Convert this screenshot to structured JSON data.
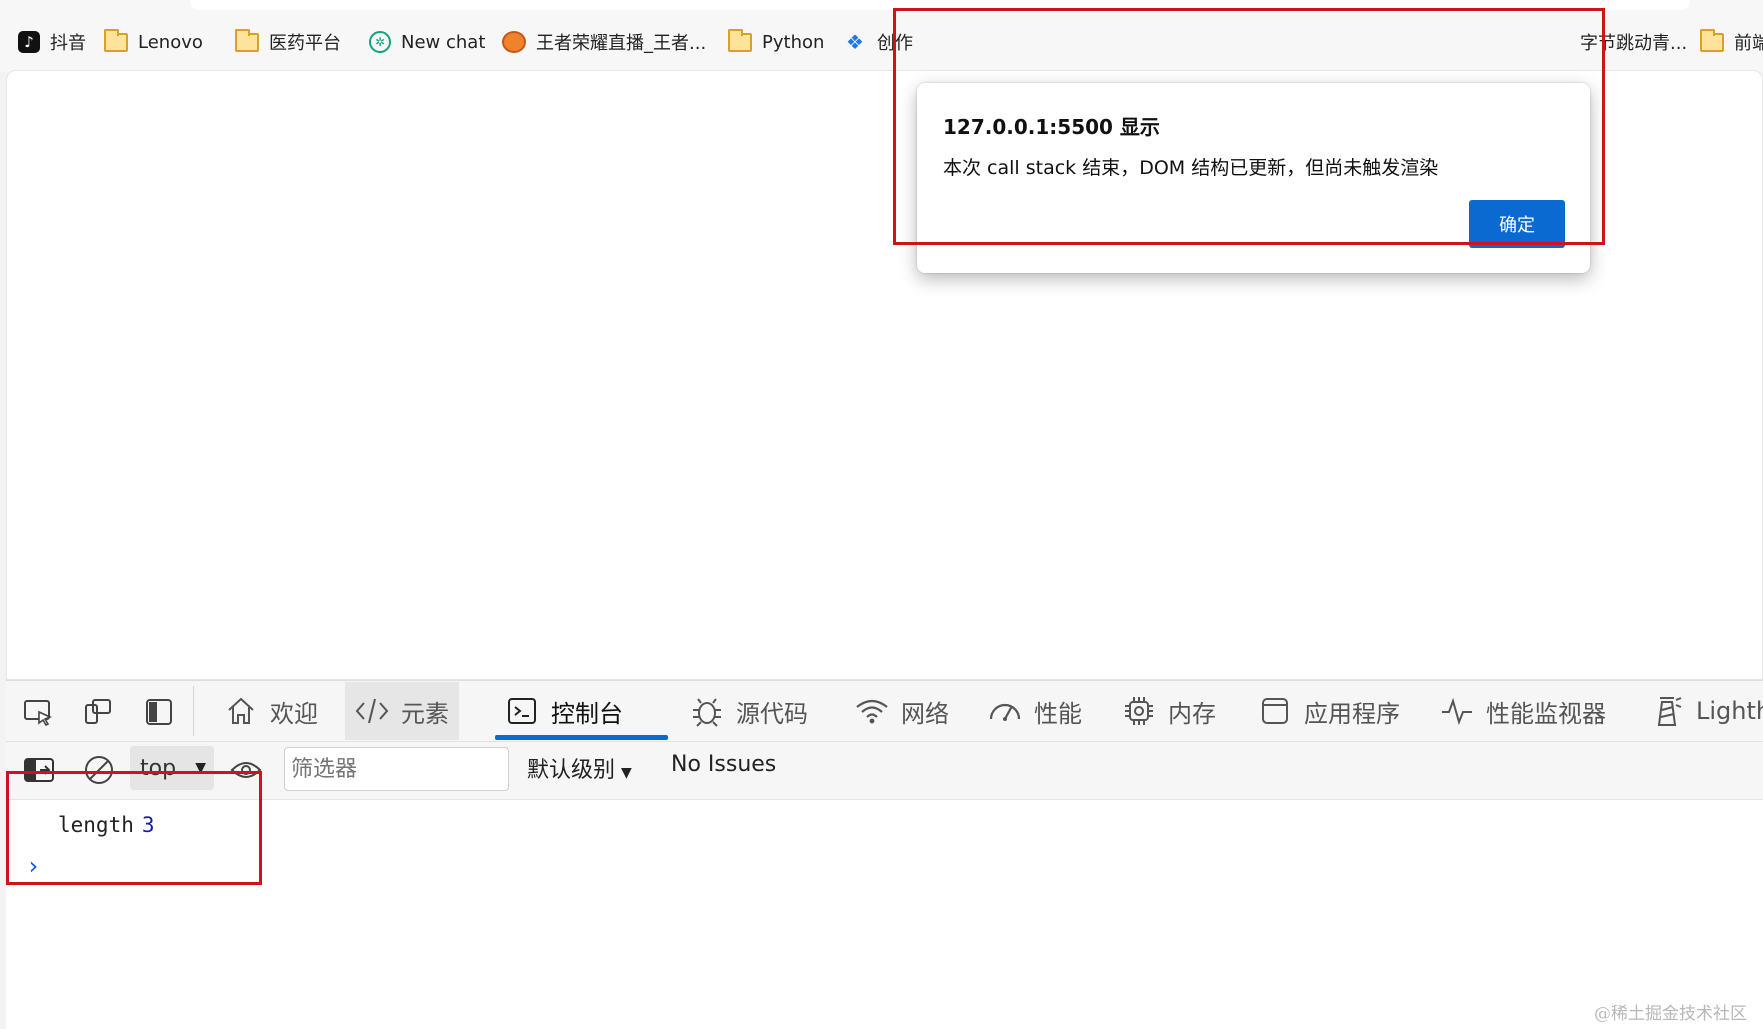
{
  "bookmarks": [
    {
      "label": "抖音",
      "icon": "tiktok-icon"
    },
    {
      "label": "Lenovo",
      "icon": "folder-icon"
    },
    {
      "label": "医药平台",
      "icon": "folder-icon"
    },
    {
      "label": "New chat",
      "icon": "openai-icon"
    },
    {
      "label": "王者荣耀直播_王者...",
      "icon": "game-icon"
    },
    {
      "label": "Python",
      "icon": "folder-icon"
    },
    {
      "label": "创作",
      "icon": "diamond-icon"
    },
    {
      "label": "字节跳动青...",
      "icon": "folder-icon"
    },
    {
      "label": "前端",
      "icon": "folder-icon"
    }
  ],
  "dialog": {
    "origin": "127.0.0.1:5500 显示",
    "message": "本次 call stack 结束，DOM 结构已更新，但尚未触发渲染",
    "ok_label": "确定"
  },
  "devtools": {
    "tabs": [
      {
        "label": "欢迎",
        "icon": "home-icon"
      },
      {
        "label": "元素",
        "icon": "code-icon"
      },
      {
        "label": "控制台",
        "icon": "console-icon"
      },
      {
        "label": "源代码",
        "icon": "bug-icon"
      },
      {
        "label": "网络",
        "icon": "wifi-icon"
      },
      {
        "label": "性能",
        "icon": "gauge-icon"
      },
      {
        "label": "内存",
        "icon": "chip-icon"
      },
      {
        "label": "应用程序",
        "icon": "app-window-icon"
      },
      {
        "label": "性能监视器",
        "icon": "pulse-icon"
      },
      {
        "label": "Lighthouse",
        "icon": "lighthouse-icon"
      }
    ],
    "active_tab": "控制台",
    "toolbar": {
      "context": "top",
      "filter_placeholder": "筛选器",
      "level": "默认级别",
      "issues": "No Issues"
    },
    "console": {
      "log_key": "length",
      "log_value": "3",
      "prompt": "›"
    }
  },
  "watermark": "@稀土掘金技术社区",
  "colors": {
    "accent": "#0b6ad1",
    "highlight_box": "#d0121b"
  }
}
